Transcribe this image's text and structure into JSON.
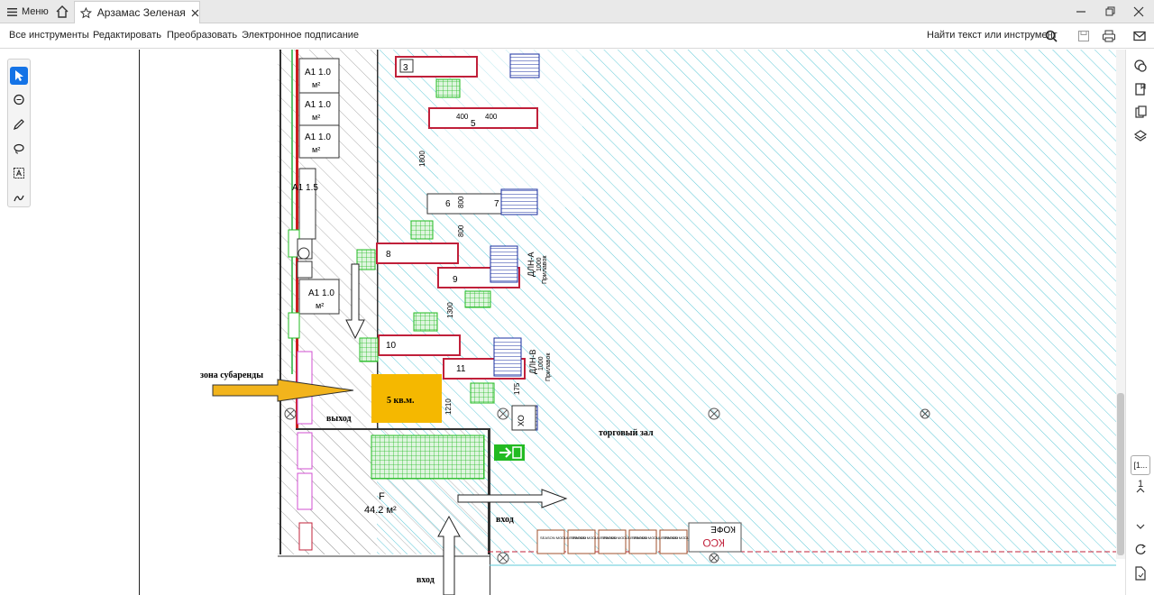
{
  "tabbar": {
    "menu_label": "Меню",
    "tab_title": "Арзамас Зеленая З..."
  },
  "toolbar": {
    "items": [
      "Все инструменты",
      "Редактировать",
      "Преобразовать",
      "Электронное подписание"
    ],
    "search_label": "Найти текст или инструмент"
  },
  "drawing": {
    "labels": {
      "zone_sublease": "зона субаренды",
      "area_box": "5 кв.м.",
      "exit": "выход",
      "sales_hall": "торговый зал",
      "entrance_1": "вход",
      "entrance_2": "вход",
      "zone_f": "F",
      "zone_f_area": "44.2 м²",
      "a1_1": "А1 1.0",
      "a1_2": "А1 1.0",
      "a1_3": "А1 1.0",
      "a1_big": "А1 1.5",
      "a1_lower": "А1 1.0",
      "m2": "м²",
      "dim_1800": "1800",
      "dim_800a": "800",
      "dim_800b": "800",
      "dim_1300": "1300",
      "dim_1210": "1210",
      "dim_175": "175",
      "checkout_3": "3",
      "checkout_5": "5",
      "checkout_6": "6",
      "checkout_7": "7",
      "checkout_8": "8",
      "checkout_9": "9",
      "checkout_10": "10",
      "checkout_11": "11",
      "r400a": "400",
      "r400b": "400",
      "dln_a": "ДЛН-А",
      "dln_b": "ДЛН-В",
      "dln_1000": "1000",
      "dln_pos": "Прилавок",
      "xo": "ХО",
      "coffee": "КОФЕ",
      "kso": "КСО",
      "season": "SEASON MODULE PROMO"
    },
    "colors": {
      "arrow_fill": "#f2b41c",
      "area_box": "#f5b800",
      "hatch_blue": "#5ec9d8",
      "checkout_red": "#c0203a",
      "cart_green": "#22bb22",
      "shelf_blue": "#1a2fa0",
      "wall_red": "#cc1f1f",
      "pink": "#d04fd0"
    }
  },
  "rightrail": {
    "page_box": "[1...",
    "page_number": "1"
  }
}
